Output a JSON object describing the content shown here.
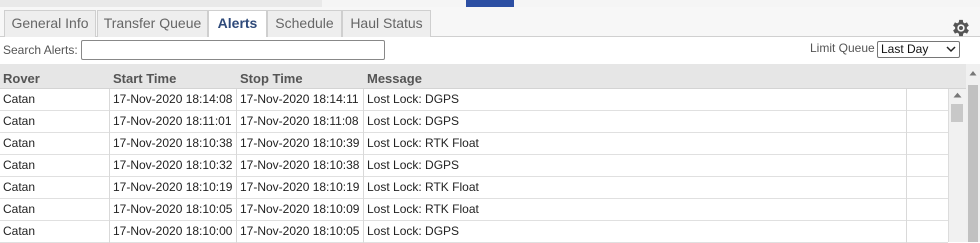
{
  "tabs": [
    {
      "label": "General Info",
      "active": false
    },
    {
      "label": "Transfer Queue",
      "active": false
    },
    {
      "label": "Alerts",
      "active": true
    },
    {
      "label": "Schedule",
      "active": false
    },
    {
      "label": "Haul Status",
      "active": false
    }
  ],
  "search": {
    "label": "Search Alerts:",
    "value": "",
    "placeholder": ""
  },
  "limit": {
    "label": "Limit Queue",
    "selected": "Last Day"
  },
  "columns": [
    "Rover",
    "Start Time",
    "Stop Time",
    "Message"
  ],
  "rows": [
    {
      "rover": "Catan",
      "start": "17-Nov-2020 18:14:08",
      "stop": "17-Nov-2020 18:14:11",
      "message": "Lost Lock: DGPS"
    },
    {
      "rover": "Catan",
      "start": "17-Nov-2020 18:11:01",
      "stop": "17-Nov-2020 18:11:08",
      "message": "Lost Lock: DGPS"
    },
    {
      "rover": "Catan",
      "start": "17-Nov-2020 18:10:38",
      "stop": "17-Nov-2020 18:10:39",
      "message": "Lost Lock: RTK Float"
    },
    {
      "rover": "Catan",
      "start": "17-Nov-2020 18:10:32",
      "stop": "17-Nov-2020 18:10:38",
      "message": "Lost Lock: DGPS"
    },
    {
      "rover": "Catan",
      "start": "17-Nov-2020 18:10:19",
      "stop": "17-Nov-2020 18:10:19",
      "message": "Lost Lock: RTK Float"
    },
    {
      "rover": "Catan",
      "start": "17-Nov-2020 18:10:05",
      "stop": "17-Nov-2020 18:10:09",
      "message": "Lost Lock: RTK Float"
    },
    {
      "rover": "Catan",
      "start": "17-Nov-2020 18:10:00",
      "stop": "17-Nov-2020 18:10:05",
      "message": "Lost Lock: DGPS"
    }
  ],
  "icons": {
    "settings": "gear-icon",
    "dropdown": "chevron-down-icon",
    "scroll_up": "arrow-up-icon"
  },
  "colors": {
    "active_tab_text": "#2f4a7a",
    "accent_bar": "#2c4fa3",
    "header_bg": "#e6e6e6"
  }
}
